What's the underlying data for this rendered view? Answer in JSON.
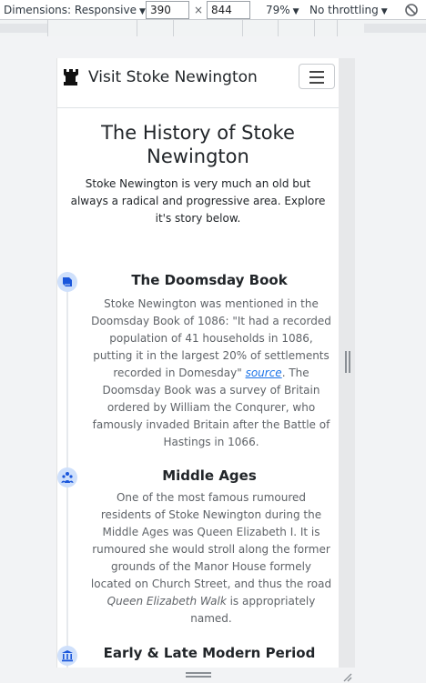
{
  "devtools": {
    "dimensions_label": "Dimensions: Responsive",
    "width": "390",
    "times": "×",
    "height": "844",
    "zoom": "79%",
    "throttling": "No throttling",
    "rotate_icon": "rotate-icon"
  },
  "site": {
    "brand": "Visit Stoke Newington",
    "brand_icon": "rook-icon",
    "menu_icon": "hamburger-icon"
  },
  "hero": {
    "title": "The History of Stoke Newington",
    "intro": "Stoke Newington is very much an old but always a radical and progressive area. Explore it's story below."
  },
  "timeline": [
    {
      "icon": "book-icon",
      "title": "The Doomsday Book",
      "text_before": "Stoke Newington was mentioned in the Doomsday Book of 1086: \"It had a recorded population of 41 households in 1086, putting it in the largest 20% of settlements recorded in Domesday\" ",
      "link": "source",
      "text_after": ". The Doomsday Book was a survey of Britain ordered by William the Conqurer, who famously invaded Britain after the Battle of Hastings in 1066."
    },
    {
      "icon": "people-icon",
      "title": "Middle Ages",
      "text_before": "One of the most famous rumoured residents of Stoke Newington during the Middle Ages was Queen Elizabeth I. It is rumoured she would stroll along the former grounds of the Manor House formely located on Church Street, and thus the road ",
      "emphasis": "Queen Elizabeth Walk",
      "text_after": " is appropriately named."
    },
    {
      "icon": "museum-icon",
      "title": "Early & Late Modern Period"
    }
  ]
}
